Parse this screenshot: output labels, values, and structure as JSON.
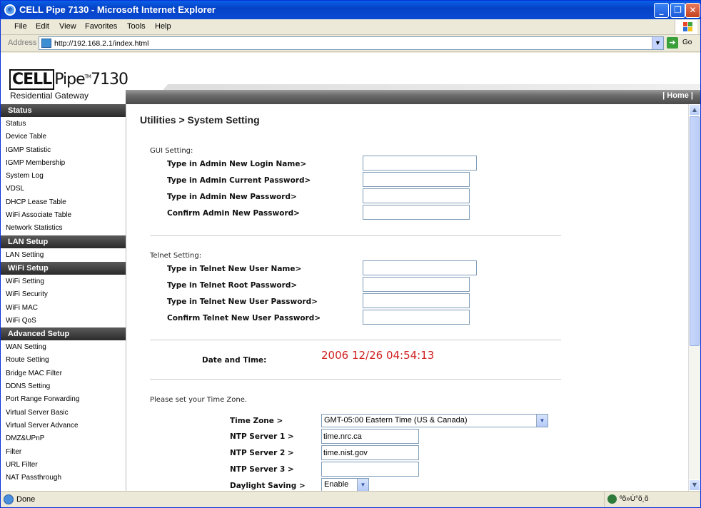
{
  "window": {
    "title": "CELL Pipe 7130 - Microsoft Internet Explorer",
    "ie_icon": "e",
    "controls": [
      "_",
      "❐",
      "✕"
    ]
  },
  "menu": [
    "File",
    "Edit",
    "View",
    "Favorites",
    "Tools",
    "Help"
  ],
  "address": {
    "label": "Address",
    "url": "http://192.168.2.1/index.html",
    "go": "Go"
  },
  "logo": {
    "cell": "CELL",
    "pipe": "Pipe",
    "tm": "TM",
    "model": "7130",
    "subtitle": "Residential Gateway"
  },
  "header": {
    "home": "| Home |"
  },
  "sidebar": {
    "status": {
      "title": "Status",
      "items": [
        "Status",
        "Device Table",
        "IGMP Statistic",
        "IGMP Membership",
        "System Log",
        "VDSL",
        "DHCP Lease Table",
        "WiFi Associate Table",
        "Network Statistics"
      ]
    },
    "lan": {
      "title": "LAN Setup",
      "items": [
        "LAN Setting"
      ]
    },
    "wifi": {
      "title": "WiFi Setup",
      "items": [
        "WiFi Setting",
        "WiFi Security",
        "WiFi MAC",
        "WiFi QoS"
      ]
    },
    "advanced": {
      "title": "Advanced Setup",
      "items": [
        "WAN Setting",
        "Route Setting",
        "Bridge MAC Filter",
        "DDNS Setting",
        "Port Range Forwarding",
        "Virtual Server Basic",
        "Virtual Server Advance",
        "DMZ&UPnP",
        "Filter",
        "URL Filter",
        "NAT Passthrough"
      ]
    }
  },
  "page": {
    "heading": "Utilities > System Setting",
    "gui": {
      "title": "GUI Setting:",
      "fields": [
        {
          "label": "Type in Admin New Login Name>",
          "value": ""
        },
        {
          "label": "Type in Admin Current Password>",
          "value": ""
        },
        {
          "label": "Type in Admin New Password>",
          "value": ""
        },
        {
          "label": "Confirm Admin New Password>",
          "value": ""
        }
      ]
    },
    "telnet": {
      "title": "Telnet Setting:",
      "fields": [
        {
          "label": "Type in Telnet New User Name>",
          "value": ""
        },
        {
          "label": "Type in Telnet Root Password>",
          "value": ""
        },
        {
          "label": "Type in Telnet New User Password>",
          "value": ""
        },
        {
          "label": "Confirm Telnet New User Password>",
          "value": ""
        }
      ]
    },
    "datetime": {
      "label": "Date and Time:",
      "value": "2006 12/26 04:54:13"
    },
    "timezone": {
      "intro": "Please set your Time Zone.",
      "zone_label": "Time Zone >",
      "zone_value": "GMT-05:00 Eastern Time (US & Canada)",
      "ntp1_label": "NTP Server 1 >",
      "ntp1_value": "time.nrc.ca",
      "ntp2_label": "NTP Server 2 >",
      "ntp2_value": "time.nist.gov",
      "ntp3_label": "NTP Server 3 >",
      "ntp3_value": "",
      "dst_label": "Daylight Saving >",
      "dst_value": "Enable"
    }
  },
  "status": {
    "text": "Done",
    "zone": "ºõ»Ú°õ¸õ"
  }
}
